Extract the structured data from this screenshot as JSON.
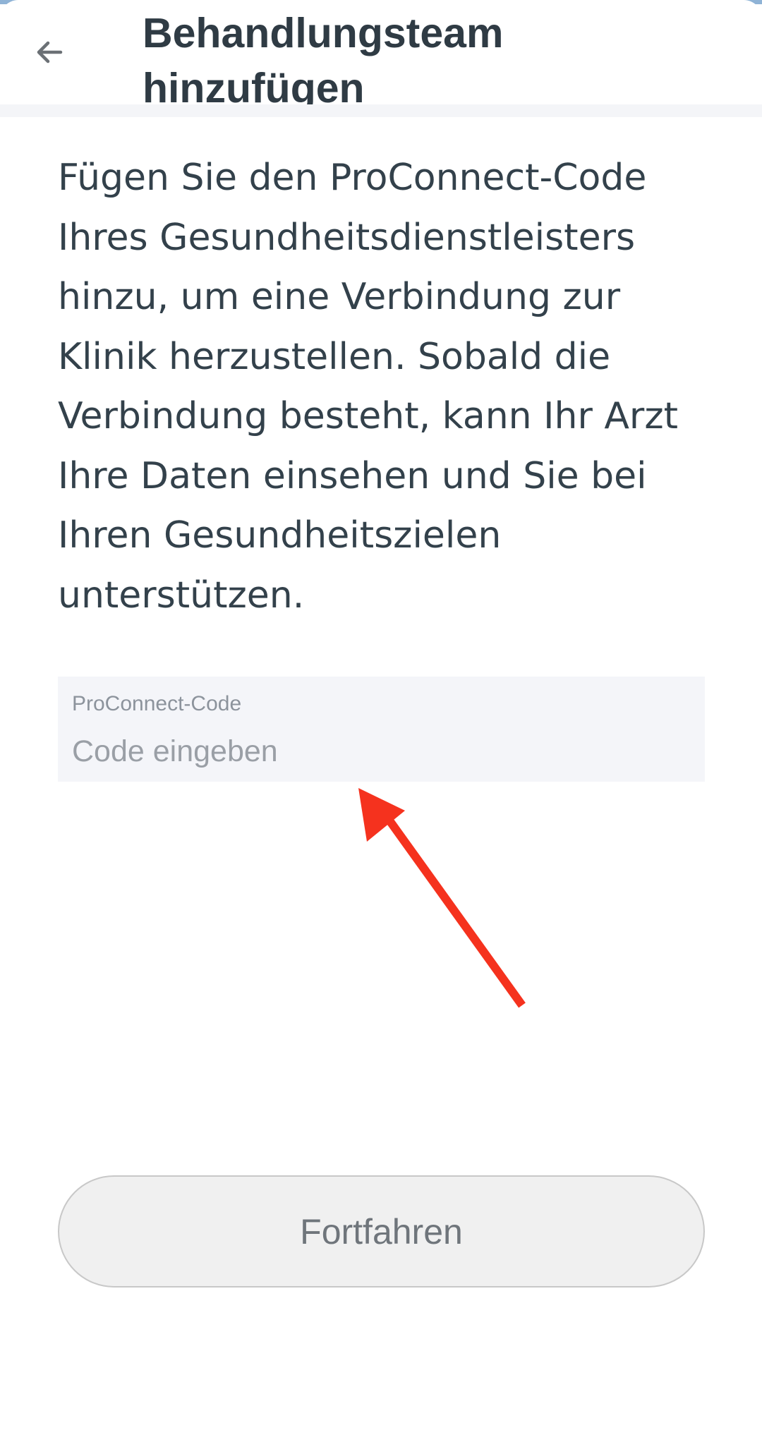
{
  "header": {
    "back_icon": "arrow-left-icon",
    "title": "Behandlungsteam hinzufügen"
  },
  "intro": {
    "text": "Fügen Sie den ProConnect-Code Ihres Gesundheitsdienstleisters hinzu, um eine Verbindung zur Klinik herzustellen. Sobald die Verbindung besteht, kann Ihr Arzt Ihre Daten einsehen und Sie bei Ihren Gesundheitszielen unterstützen."
  },
  "code_field": {
    "label": "ProConnect-Code",
    "placeholder": "Code eingeben",
    "value": ""
  },
  "annotation": {
    "icon": "red-arrow-annotation",
    "color": "#f5321e"
  },
  "continue_button": {
    "label": "Fortfahren",
    "state": "disabled"
  },
  "colors": {
    "top_strip": "#8fb3d6",
    "text": "#33414b",
    "field_background": "#f4f5f9",
    "button_background": "#f0f0f0"
  }
}
